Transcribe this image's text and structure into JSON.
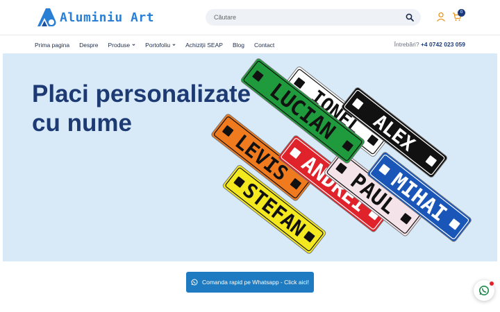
{
  "brand": {
    "name": "Aluminiu Art",
    "accent": "#2a7fd4"
  },
  "search": {
    "placeholder": "Căutare"
  },
  "cart": {
    "count": "0"
  },
  "nav": {
    "items": [
      {
        "label": "Prima pagina"
      },
      {
        "label": "Despre"
      },
      {
        "label": "Produse"
      },
      {
        "label": "Portofoliu"
      },
      {
        "label": "Achiziții SEAP"
      },
      {
        "label": "Blog"
      },
      {
        "label": "Contact"
      }
    ],
    "phone_question": "Întrebări?",
    "phone_number": "+4 0742 023 059"
  },
  "hero": {
    "title_line1": "Placi personalizate",
    "title_line2": "cu nume",
    "plates": [
      {
        "name": "LUCIAN",
        "bg": "#1f9a3c",
        "fg": "#111111"
      },
      {
        "name": "IONEL",
        "bg": "#ffffff",
        "fg": "#111111"
      },
      {
        "name": "ALEX",
        "bg": "#111111",
        "fg": "#ffffff"
      },
      {
        "name": "LEVIS",
        "bg": "#f07a1e",
        "fg": "#111111"
      },
      {
        "name": "ANDREI",
        "bg": "#e0232b",
        "fg": "#ffffff"
      },
      {
        "name": "PAUL",
        "bg": "#f5e3ea",
        "fg": "#111111"
      },
      {
        "name": "MIHAI",
        "bg": "#1a55b8",
        "fg": "#ffffff"
      },
      {
        "name": "STEFAN",
        "bg": "#f4e81e",
        "fg": "#111111"
      }
    ]
  },
  "cta": {
    "label": "Comanda rapid pe Whatsapp - Click aici!"
  }
}
